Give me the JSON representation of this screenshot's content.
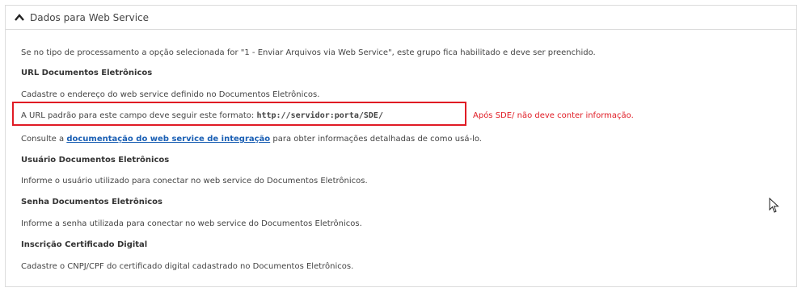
{
  "panel": {
    "title": "Dados para Web Service"
  },
  "content": {
    "intro": "Se no tipo de processamento a opção selecionada for \"1 - Enviar Arquivos via Web Service\", este grupo fica habilitado e deve ser preenchido.",
    "url_heading": "URL Documentos Eletrônicos",
    "url_desc": "Cadastre o endereço do web service definido no Documentos Eletrônicos.",
    "url_format_prefix": "A URL padrão para este campo deve seguir este formato: ",
    "url_format_value": "http://servidor:porta/SDE/",
    "url_note": "Após SDE/ não deve conter informação.",
    "consult_prefix": "Consulte a ",
    "consult_link": "documentação do web service de integração",
    "consult_suffix": " para obter informações detalhadas de como usá-lo.",
    "user_heading": "Usuário Documentos Eletrônicos",
    "user_desc": "Informe o usuário utilizado para conectar no web service do Documentos Eletrônicos.",
    "pass_heading": "Senha Documentos Eletrônicos",
    "pass_desc": "Informe a senha utilizada para conectar no web service do Documentos Eletrônicos.",
    "cert_heading": "Inscrição Certificado Digital",
    "cert_desc": "Cadastre o CNPJ/CPF do certificado digital cadastrado no Documentos Eletrônicos."
  },
  "icons": {
    "collapse": "chevron-up-icon",
    "pointer": "mouse-cursor-icon"
  },
  "colors": {
    "highlight": "#e01b24",
    "link": "#1a5fb4"
  }
}
